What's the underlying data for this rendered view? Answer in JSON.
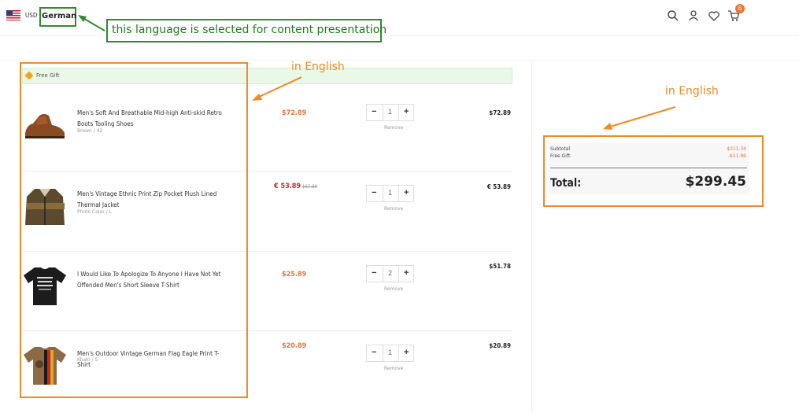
{
  "header": {
    "currency": "USD",
    "language": "German",
    "cart_count": "6",
    "icons": [
      "search-icon",
      "user-icon",
      "heart-icon",
      "cart-icon"
    ]
  },
  "annotations": {
    "language_note": "this language is selected for content presentation",
    "products_note": "in English",
    "summary_note": "in English"
  },
  "cart": {
    "gift_label": "Free Gift",
    "remove_label": "Remove",
    "items": [
      {
        "name": "Men's Soft And Breathable Mid-high Anti-skid Retro Boots Tooling Shoes",
        "variant": "Brown / 42",
        "price": "$72.89",
        "old_price": "",
        "quantity": "1",
        "subtotal": "$72.89"
      },
      {
        "name": "Men's Vintage Ethnic Print Zip Pocket Plush Lined Thermal Jacket",
        "variant": "Photo Color / L",
        "price": "€ 53.89",
        "old_price": "$67.89",
        "quantity": "1",
        "subtotal": "€ 53.89"
      },
      {
        "name": "I Would Like To Apologize To Anyone I Have Not Yet Offended Men's Short Sleeve T-Shirt",
        "variant": "",
        "price": "$25.89",
        "old_price": "",
        "quantity": "2",
        "subtotal": "$51.78"
      },
      {
        "name": "Men's Outdoor Vintage German Flag Eagle Print T-Shirt",
        "variant": "Khaki / S",
        "price": "$20.89",
        "old_price": "",
        "quantity": "1",
        "subtotal": "$20.89"
      }
    ]
  },
  "summary": {
    "subtotal_label": "Subtotal",
    "subtotal_value": "$311.34",
    "gift_label": "Free Gift",
    "gift_value": "-$11.89",
    "total_label": "Total:",
    "total_value": "$299.45"
  },
  "colors": {
    "accent_orange": "#f08a24",
    "price_orange": "#e8743b",
    "sale_red": "#d0262c",
    "annotation_green": "#2e8b2e"
  }
}
